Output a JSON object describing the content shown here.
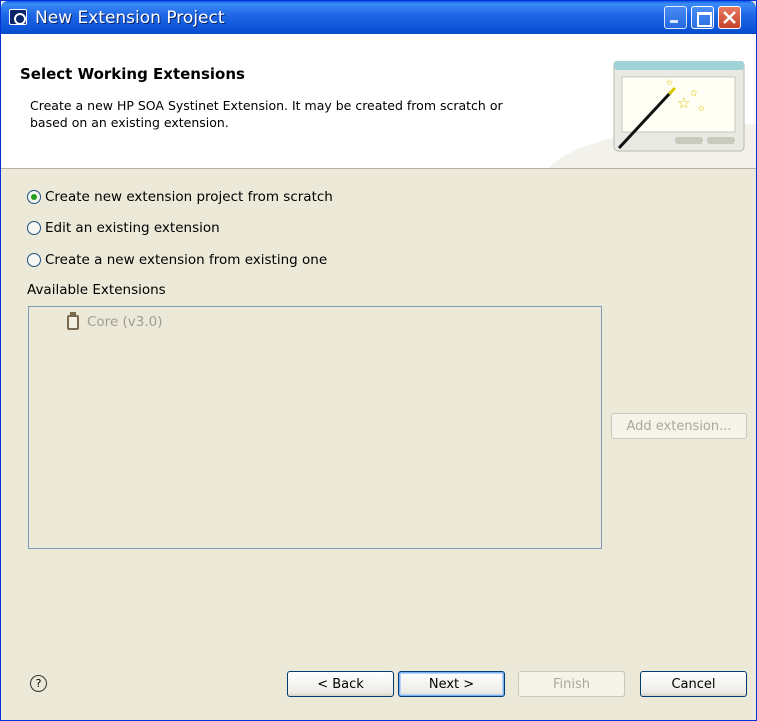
{
  "window": {
    "title": "New Extension Project"
  },
  "header": {
    "title": "Select Working Extensions",
    "description": "Create a new HP SOA Systinet Extension. It may be created from scratch or based on an existing extension."
  },
  "options": [
    {
      "label": "Create new extension project from scratch",
      "selected": true
    },
    {
      "label": "Edit an existing extension",
      "selected": false
    },
    {
      "label": "Create a new extension from existing one",
      "selected": false
    }
  ],
  "extensions": {
    "label": "Available Extensions",
    "items": [
      {
        "label": "Core (v3.0)",
        "icon": "jar-icon",
        "enabled": false
      }
    ],
    "add_button": "Add extension..."
  },
  "footer": {
    "help_icon": "?",
    "back": "< Back",
    "next": "Next >",
    "finish": "Finish",
    "cancel": "Cancel"
  },
  "colors": {
    "titlebar": "#0b54d8",
    "dialog_bg": "#ece9d8",
    "radio_checked": "#21a121"
  }
}
